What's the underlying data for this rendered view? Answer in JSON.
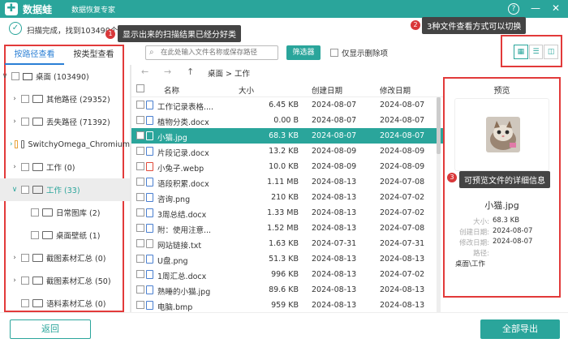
{
  "titlebar": {
    "app_name": "数据蛙",
    "subtitle": "数据恢复专家",
    "help": "?",
    "minimize": "—",
    "close": "✕"
  },
  "scan": {
    "prefix": "扫描完成，找到103490个文件（已占据）"
  },
  "annotations": [
    {
      "num": "1",
      "text": "显示出来的扫描结果已经分好类"
    },
    {
      "num": "2",
      "text": "3种文件查看方式可以切换"
    },
    {
      "num": "3",
      "text": "可预览文件的详细信息"
    }
  ],
  "tabs": [
    {
      "label": "按路径查看"
    },
    {
      "label": "按类型查看"
    }
  ],
  "tree": [
    {
      "arrow": "∨",
      "label": "桌面 (103490)"
    },
    {
      "arrow": "›",
      "label": "其他路径 (29352)"
    },
    {
      "arrow": "›",
      "label": "丢失路径 (71392)"
    },
    {
      "arrow": "›",
      "label": "SwitchyOmega_Chromium"
    },
    {
      "arrow": "›",
      "label": "工作 (0)"
    },
    {
      "arrow": "∨",
      "label": "工作 (33)"
    },
    {
      "arrow": "",
      "label": "日常图库 (2)"
    },
    {
      "arrow": "",
      "label": "桌面壁纸 (1)"
    },
    {
      "arrow": "›",
      "label": "截图素材汇总 (0)"
    },
    {
      "arrow": "›",
      "label": "截图素材汇总 (50)"
    },
    {
      "arrow": "",
      "label": "语料素材汇总 (0)"
    }
  ],
  "search": {
    "placeholder": "在此处输入文件名称或保存路径"
  },
  "filter_label": "筛选器",
  "show_deleted": "仅显示删除项",
  "crumb": "桌面 > 工作",
  "columns": {
    "name": "名称",
    "size": "大小",
    "created": "创建日期",
    "modified": "修改日期"
  },
  "files": [
    {
      "name": "工作记录表格....",
      "size": "6.45 KB",
      "created": "2024-08-07",
      "modified": "2024-08-07"
    },
    {
      "name": "植物分类.docx",
      "size": "0.00 B",
      "created": "2024-08-07",
      "modified": "2024-08-07"
    },
    {
      "name": "小猫.jpg",
      "size": "68.3 KB",
      "created": "2024-08-07",
      "modified": "2024-08-07"
    },
    {
      "name": "片段记录.docx",
      "size": "13.2 KB",
      "created": "2024-08-09",
      "modified": "2024-08-09"
    },
    {
      "name": "小兔子.webp",
      "size": "10.0 KB",
      "created": "2024-08-09",
      "modified": "2024-08-09"
    },
    {
      "name": "语段积累.docx",
      "size": "1.11 MB",
      "created": "2024-08-13",
      "modified": "2024-07-08"
    },
    {
      "name": "咨询.png",
      "size": "210 KB",
      "created": "2024-08-13",
      "modified": "2024-07-02"
    },
    {
      "name": "3周总结.docx",
      "size": "1.33 MB",
      "created": "2024-08-13",
      "modified": "2024-07-02"
    },
    {
      "name": "附：使用注意...",
      "size": "1.52 MB",
      "created": "2024-08-13",
      "modified": "2024-07-08"
    },
    {
      "name": "网站链接.txt",
      "size": "1.63 KB",
      "created": "2024-07-31",
      "modified": "2024-07-31"
    },
    {
      "name": "U盘.png",
      "size": "51.3 KB",
      "created": "2024-08-13",
      "modified": "2024-08-13"
    },
    {
      "name": "1周汇总.docx",
      "size": "996 KB",
      "created": "2024-08-13",
      "modified": "2024-07-02"
    },
    {
      "name": "熟睡的小猫.jpg",
      "size": "89.6 KB",
      "created": "2024-08-13",
      "modified": "2024-08-13"
    },
    {
      "name": "电脑.bmp",
      "size": "959 KB",
      "created": "2024-08-13",
      "modified": "2024-08-13"
    }
  ],
  "preview": {
    "title": "预览",
    "filename": "小猫.jpg",
    "meta": [
      {
        "k": "大小:",
        "v": "68.3 KB"
      },
      {
        "k": "创建日期:",
        "v": "2024-08-07"
      },
      {
        "k": "修改日期:",
        "v": "2024-08-07"
      },
      {
        "k": "路径:",
        "v": ""
      },
      {
        "k": "",
        "v": "桌面\\工作"
      }
    ]
  },
  "buttons": {
    "back": "返回",
    "export": "全部导出"
  },
  "colors": {
    "accent": "#2aa59b",
    "annotation_red": "#e23a3a",
    "tab_blue": "#2a7fd5"
  }
}
